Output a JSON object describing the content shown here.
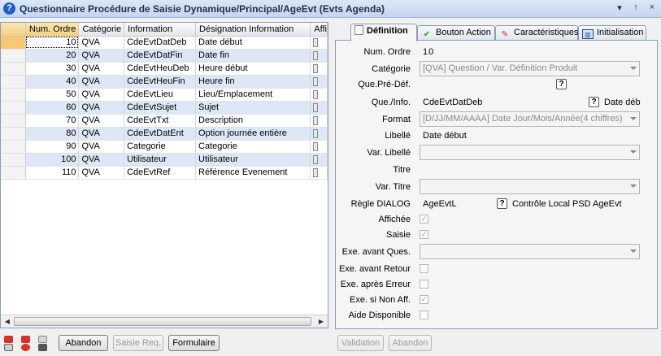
{
  "window": {
    "title": "Questionnaire Procédure de Saisie Dynamique/Principal/AgeEvt (Evts Agenda)",
    "controls": [
      "▾",
      "↑",
      "×"
    ]
  },
  "grid": {
    "columns": [
      "Num. Ordre",
      "Catégorie",
      "Information",
      "Désignation Information",
      "Affi"
    ],
    "rows": [
      [
        "10",
        "QVA",
        "CdeEvtDatDeb",
        "Date début"
      ],
      [
        "20",
        "QVA",
        "CdeEvtDatFin",
        "Date fin"
      ],
      [
        "30",
        "QVA",
        "CdeEvtHeuDeb",
        "Heure début"
      ],
      [
        "40",
        "QVA",
        "CdeEvtHeuFin",
        "Heure fin"
      ],
      [
        "50",
        "QVA",
        "CdeEvtLieu",
        "Lieu/Emplacement"
      ],
      [
        "60",
        "QVA",
        "CdeEvtSujet",
        "Sujet"
      ],
      [
        "70",
        "QVA",
        "CdeEvtTxt",
        "Description"
      ],
      [
        "80",
        "QVA",
        "CdeEvtDatEnt",
        "Option journée entière"
      ],
      [
        "90",
        "QVA",
        "Categorie",
        "Categorie"
      ],
      [
        "100",
        "QVA",
        "Utilisateur",
        "Utilisateur"
      ],
      [
        "110",
        "QVA",
        "CdeEvtRef",
        "Référence Evenement"
      ]
    ]
  },
  "bottom_left": {
    "abandon": "Abandon",
    "saisie_req": "Saisie Req.",
    "formulaire": "Formulaire"
  },
  "tabs": [
    {
      "label": "Définition",
      "icon": "document-icon"
    },
    {
      "label": "Bouton Action",
      "icon": "checkmark-icon"
    },
    {
      "label": "Caractéristiques",
      "icon": "edit-icon"
    },
    {
      "label": "Initialisation",
      "icon": "chart-icon"
    }
  ],
  "form": {
    "num_ordre": {
      "label": "Num. Ordre",
      "value": "10"
    },
    "categorie": {
      "label": "Catégorie",
      "value": "[QVA] Question / Var. Définition Produit"
    },
    "que_pre_def": {
      "label": "Que.Pré-Déf.",
      "help": "?"
    },
    "que_info": {
      "label": "Que./Info.",
      "value": "CdeEvtDatDeb",
      "help": "?",
      "extra": "Date déb"
    },
    "format": {
      "label": "Format",
      "value": "[D/JJ/MM/AAAA] Date Jour/Mois/Année(4 chiffres)"
    },
    "libelle": {
      "label": "Libellé",
      "value": "Date début"
    },
    "var_libelle": {
      "label": "Var. Libellé",
      "value": ""
    },
    "titre": {
      "label": "Titre",
      "value": ""
    },
    "var_titre": {
      "label": "Var. Titre",
      "value": ""
    },
    "regle_dialog": {
      "label": "Règle DIALOG",
      "value": "AgeEvtL",
      "help": "?",
      "extra": "Contrôle Local  PSD AgeEvt"
    },
    "affichee": {
      "label": "Affichée",
      "checked": true
    },
    "saisie": {
      "label": "Saisie",
      "checked": true
    },
    "exe_avant_ques": {
      "label": "Exe. avant Ques.",
      "value": ""
    },
    "exe_avant_retour": {
      "label": "Exe. avant Retour",
      "checked": false
    },
    "exe_apres_erreur": {
      "label": "Exe. après Erreur",
      "checked": false
    },
    "exe_si_non_aff": {
      "label": "Exe. si Non Aff.",
      "checked": true
    },
    "aide_disponible": {
      "label": "Aide Disponible",
      "checked": false
    }
  },
  "bottom_right": {
    "validation": "Validation",
    "abandon": "Abandon"
  }
}
